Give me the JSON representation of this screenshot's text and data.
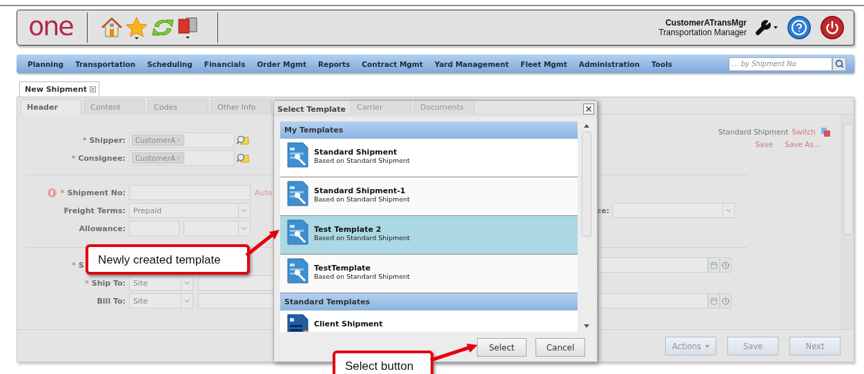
{
  "header": {
    "logo": "one",
    "user_name": "CustomerATransMgr",
    "user_role": "Transportation Manager"
  },
  "nav": {
    "items": [
      "Planning",
      "Transportation",
      "Scheduling",
      "Financials",
      "Order Mgmt",
      "Reports",
      "Contract Mgmt",
      "Yard Management",
      "Fleet Mgmt",
      "Administration",
      "Tools"
    ],
    "search_placeholder": "... by Shipment No"
  },
  "page_tabs": [
    {
      "label": "New Shipment",
      "selected": true
    }
  ],
  "form_tabs": [
    {
      "label": "Header",
      "selected": true
    },
    {
      "label": "Content",
      "selected": false
    },
    {
      "label": "Codes",
      "selected": false
    },
    {
      "label": "Other Info",
      "selected": false
    },
    {
      "label": "Carrier",
      "selected": false
    },
    {
      "label": "Documents",
      "selected": false
    }
  ],
  "template_info": {
    "name": "Standard Shipment",
    "switch_link": "Switch",
    "save_link": "Save",
    "save_as_link": "Save As..."
  },
  "form_groups": [
    {
      "rows": [
        {
          "label": "Shipper:",
          "mark": "*",
          "kind": "chip",
          "value": "CustomerA"
        },
        {
          "label": "Consignee:",
          "mark": "*",
          "kind": "chip",
          "value": "CustomerA"
        }
      ]
    },
    {
      "rows": [
        {
          "label": "Shipment No:",
          "mark": "*",
          "alert": true,
          "kind": "text",
          "note": "Auto"
        },
        {
          "label": "Freight Terms:",
          "kind": "select",
          "value": "Prepaid",
          "right": {
            "kind": "select",
            "label": "ze:"
          }
        },
        {
          "label": "Allowance:",
          "kind": "split"
        }
      ]
    },
    {
      "rows": [
        {
          "label": "S",
          "mark": "*",
          "kind": "none",
          "right": {
            "kind": "datetime"
          }
        },
        {
          "label": "Ship To:",
          "mark": "*",
          "kind": "site",
          "value": "Site"
        },
        {
          "label": "Bill To:",
          "kind": "site",
          "value": "Site",
          "right": {
            "kind": "datetime"
          }
        }
      ]
    }
  ],
  "footer_buttons": [
    {
      "label": "Actions",
      "dropdown": true
    },
    {
      "label": "Save",
      "dropdown": false
    },
    {
      "label": "Next",
      "dropdown": false
    }
  ],
  "dialog": {
    "title": "Select Template",
    "sections": [
      {
        "title": "My Templates",
        "items": [
          {
            "title": "Standard Shipment",
            "subtitle": "Based on Standard Shipment",
            "kind": "custom",
            "selected": false
          },
          {
            "title": "Standard Shipment-1",
            "subtitle": "Based on Standard Shipment",
            "kind": "custom",
            "selected": false
          },
          {
            "title": "Test Template 2",
            "subtitle": "Based on Standard Shipment",
            "kind": "custom",
            "selected": true
          },
          {
            "title": "TestTemplate",
            "subtitle": "Based on Standard Shipment",
            "kind": "custom",
            "selected": false
          }
        ]
      },
      {
        "title": "Standard Templates",
        "items": [
          {
            "title": "Client Shipment",
            "kind": "standard",
            "selected": false
          }
        ]
      }
    ],
    "buttons": [
      "Select",
      "Cancel"
    ]
  },
  "callouts": [
    {
      "text": "Newly created template"
    },
    {
      "text": "Select button"
    }
  ]
}
